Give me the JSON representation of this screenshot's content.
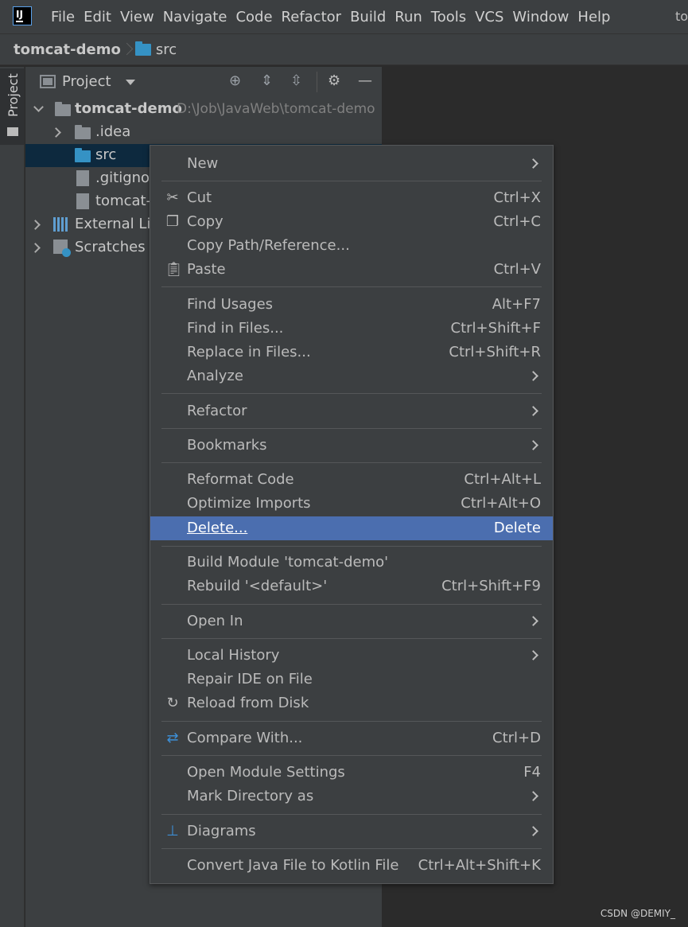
{
  "menubar": {
    "logo": "IJ",
    "items": [
      "File",
      "Edit",
      "View",
      "Navigate",
      "Code",
      "Refactor",
      "Build",
      "Run",
      "Tools",
      "VCS",
      "Window",
      "Help"
    ],
    "title_right": "to"
  },
  "navbar": {
    "project": "tomcat-demo",
    "folder": "src"
  },
  "left_strip": {
    "project_tab": "Project"
  },
  "panel": {
    "title": "Project"
  },
  "tree": {
    "root": {
      "label": "tomcat-demo",
      "path": "D:\\Job\\JavaWeb\\tomcat-demo"
    },
    "idea": ".idea",
    "src": "src",
    "gitignore": ".gitignor",
    "iml": "tomcat-d",
    "external": "External Lib",
    "scratches": "Scratches a"
  },
  "context_menu": {
    "highlighted": "Delete...",
    "items": {
      "new": {
        "label": "New",
        "icon": ""
      },
      "cut": {
        "label": "Cut",
        "shortcut": "Ctrl+X",
        "icon": "scissors-icon"
      },
      "copy": {
        "label": "Copy",
        "shortcut": "Ctrl+C",
        "icon": "copy-icon"
      },
      "copy_path": {
        "label": "Copy Path/Reference..."
      },
      "paste": {
        "label": "Paste",
        "shortcut": "Ctrl+V",
        "icon": "clipboard-icon"
      },
      "find_usages": {
        "label": "Find Usages",
        "shortcut": "Alt+F7"
      },
      "find_in_files": {
        "label": "Find in Files...",
        "shortcut": "Ctrl+Shift+F"
      },
      "replace_in_files": {
        "label": "Replace in Files...",
        "shortcut": "Ctrl+Shift+R"
      },
      "analyze": {
        "label": "Analyze"
      },
      "refactor": {
        "label": "Refactor"
      },
      "bookmarks": {
        "label": "Bookmarks"
      },
      "reformat_code": {
        "label": "Reformat Code",
        "shortcut": "Ctrl+Alt+L"
      },
      "optimize_imports": {
        "label": "Optimize Imports",
        "shortcut": "Ctrl+Alt+O"
      },
      "delete": {
        "label": "Delete...",
        "shortcut": "Delete"
      },
      "build_module": {
        "label": "Build Module 'tomcat-demo'"
      },
      "rebuild": {
        "label": "Rebuild '<default>'",
        "shortcut": "Ctrl+Shift+F9"
      },
      "open_in": {
        "label": "Open In"
      },
      "local_history": {
        "label": "Local History"
      },
      "repair_ide": {
        "label": "Repair IDE on File"
      },
      "reload_from_disk": {
        "label": "Reload from Disk",
        "icon": "reload-icon"
      },
      "compare_with": {
        "label": "Compare With...",
        "shortcut": "Ctrl+D",
        "icon": "compare-icon"
      },
      "open_module_settings": {
        "label": "Open Module Settings",
        "shortcut": "F4"
      },
      "mark_directory_as": {
        "label": "Mark Directory as"
      },
      "diagrams": {
        "label": "Diagrams",
        "icon": "diagrams-icon"
      },
      "convert_java": {
        "label": "Convert Java File to Kotlin File",
        "shortcut": "Ctrl+Alt+Shift+K"
      }
    }
  },
  "watermark": "CSDN @DEMIY_",
  "colors": {
    "background": "#2b2b2b",
    "panel": "#3c3f41",
    "highlight": "#4b6eaf",
    "selection": "#0d293e",
    "folder": "#3592c4"
  }
}
